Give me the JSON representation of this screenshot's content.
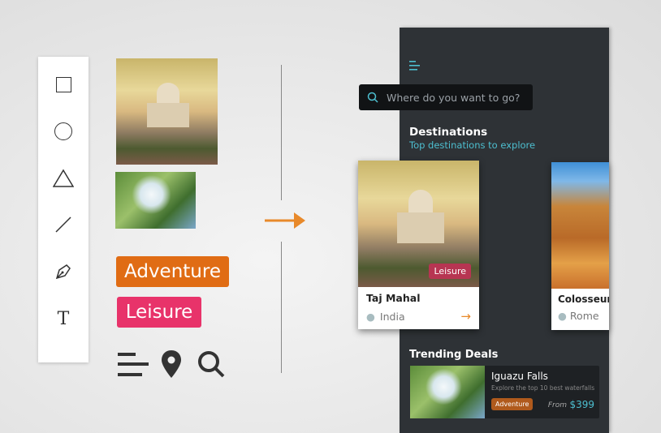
{
  "toolbar": {
    "tools": [
      "rectangle",
      "ellipse",
      "triangle",
      "line",
      "pen",
      "text"
    ],
    "text_tool_glyph": "T"
  },
  "assets": {
    "adventure_label": "Adventure",
    "leisure_label": "Leisure",
    "colors": {
      "adventure": "#e06c14",
      "leisure": "#e8336a",
      "accent": "#e8892a"
    }
  },
  "app": {
    "search_placeholder": "Where do you want to go?",
    "destinations": {
      "title": "Destinations",
      "subtitle": "Top destinations to explore",
      "cards": [
        {
          "name": "Taj Mahal",
          "location": "India",
          "tag": "Leisure"
        },
        {
          "name": "Colosseum",
          "location": "Rome"
        }
      ]
    },
    "trending": {
      "title": "Trending Deals",
      "deal": {
        "name": "Iguazu Falls",
        "desc": "Explore the top 10 best waterfalls",
        "tag": "Adventure",
        "from": "From",
        "price": "$399"
      }
    }
  }
}
